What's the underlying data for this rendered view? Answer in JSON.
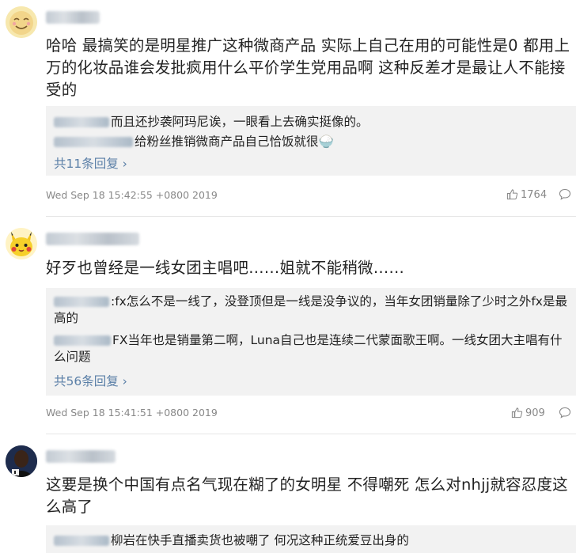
{
  "comments": [
    {
      "content": "哈哈 最搞笑的是明星推广这种微商产品 实际上自己在用的可能性是0 都用上万的化妆品谁会发批疯用什么平价学生党用品啊 这种反差才是最让人不能接受的",
      "replies": [
        {
          "text": "而且还抄袭阿玛尼诶，一眼看上去确实挺像的。"
        },
        {
          "text": "给粉丝推销微商产品自己恰饭就很🍚"
        }
      ],
      "more_replies": "共11条回复",
      "timestamp": "Wed Sep 18 15:42:55 +0800 2019",
      "likes": "1764"
    },
    {
      "content": "好歹也曾经是一线女团主唱吧……姐就不能稍微……",
      "replies": [
        {
          "text": ":fx怎么不是一线了，没登顶但是一线是没争议的，当年女团销量除了少时之外fx是最高的"
        },
        {
          "text": "FX当年也是销量第二啊，Luna自己也是连续二代蒙面歌王啊。一线女团大主唱有什么问题"
        }
      ],
      "more_replies": "共56条回复",
      "timestamp": "Wed Sep 18 15:41:51 +0800 2019",
      "likes": "909"
    },
    {
      "content": "这要是换个中国有点名气现在糊了的女明星 不得嘲死 怎么对nhjj就容忍度这么高了",
      "replies": [
        {
          "text": "柳岩在快手直播卖货也被嘲了 何况这种正统爱豆出身的"
        }
      ]
    }
  ],
  "icons": {
    "like": "thumbs-up-icon",
    "reply": "comment-bubble-icon"
  },
  "colors": {
    "link": "#5a7fa7",
    "meta": "#888888",
    "reply_bg": "#f2f2f2"
  }
}
